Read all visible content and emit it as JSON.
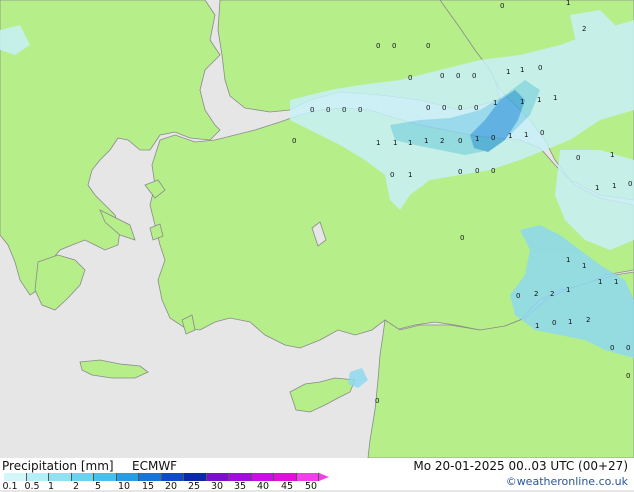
{
  "map": {
    "land_color": "#b6ee8a",
    "sea_color": "#e6e6e6",
    "border_color": "#8a8a8a",
    "precip_light": "#c8f0f8",
    "precip_mid": "#8ed8ee",
    "precip_strong": "#4aa8e2",
    "values": [
      "0",
      "0",
      "0",
      "0",
      "0",
      "0",
      "0",
      "1",
      "1",
      "0",
      "1",
      "2",
      "1",
      "1",
      "1",
      "2",
      "0",
      "0",
      "1",
      "0",
      "1",
      "0",
      "1",
      "0",
      "0",
      "0",
      "0",
      "0",
      "0",
      "0",
      "1",
      "1",
      "0",
      "1",
      "0",
      "1",
      "0",
      "0",
      "0",
      "1",
      "0",
      "1",
      "2",
      "1",
      "1",
      "1",
      "1",
      "1",
      "1",
      "0",
      "0",
      "0",
      "2",
      "2",
      "0",
      "0",
      "1",
      "0",
      "0",
      "1",
      "1",
      "0",
      "1",
      "0"
    ]
  },
  "footer": {
    "title": "Precipitation [mm]",
    "model": "ECMWF",
    "datetime": "Mo 20-01-2025 00..03 UTC (00+27)",
    "credit": "©weatheronline.co.uk",
    "legend": {
      "ticks": [
        "0.1",
        "0.5",
        "1",
        "2",
        "5",
        "10",
        "15",
        "20",
        "25",
        "30",
        "35",
        "40",
        "45",
        "50"
      ],
      "colors": [
        "#d2f6fa",
        "#b4eef6",
        "#90e2f2",
        "#6cd2ee",
        "#48c0ea",
        "#2a9ce0",
        "#1a74d6",
        "#0e4cc6",
        "#0a2aa8",
        "#7a10c8",
        "#a010d8",
        "#c810e0",
        "#e010d8",
        "#f040e8"
      ]
    }
  }
}
